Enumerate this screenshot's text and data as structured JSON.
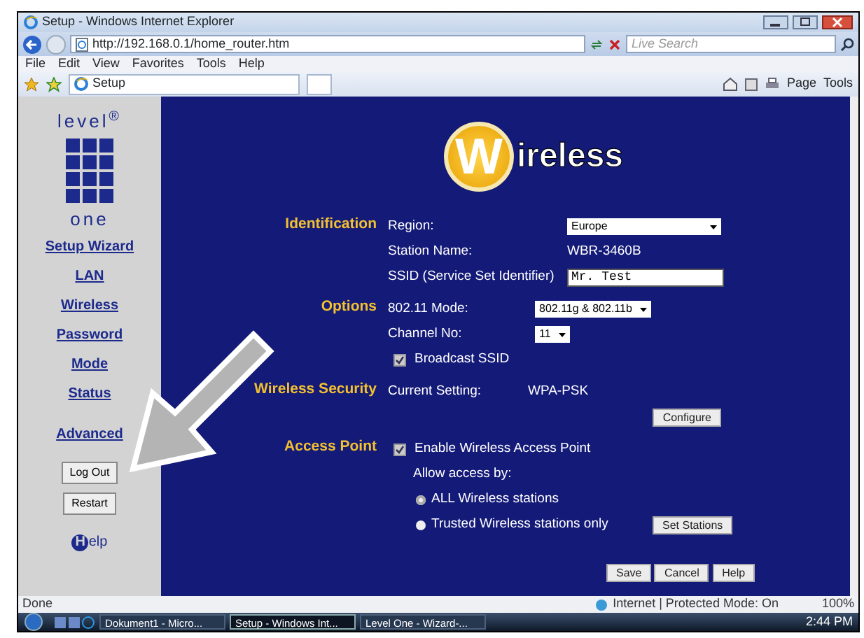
{
  "browser": {
    "title": "Setup - Windows Internet Explorer",
    "address": "http://192.168.0.1/home_router.htm",
    "search_placeholder": "Live Search",
    "menu": [
      "File",
      "Edit",
      "View",
      "Favorites",
      "Tools",
      "Help"
    ],
    "tab": "Setup",
    "tools": [
      "Page",
      "Tools"
    ]
  },
  "sidebar": {
    "logo": {
      "top": "level",
      "mark": "®",
      "bottom": "one"
    },
    "links": [
      "Setup Wizard",
      "LAN",
      "Wireless",
      "Password",
      "Mode",
      "Status"
    ],
    "advanced": "Advanced",
    "buttons": [
      "Log Out",
      "Restart"
    ],
    "help": {
      "letter": "H",
      "rest": "elp"
    }
  },
  "main": {
    "logo": {
      "letter": "W",
      "rest": "ireless"
    },
    "sections": [
      {
        "title": "Identification",
        "rows": [
          {
            "kind": "select",
            "label": "Region:",
            "value": "Europe"
          },
          {
            "kind": "text",
            "label": "Station Name:",
            "value": "WBR-3460B"
          },
          {
            "kind": "input",
            "label": "SSID (Service Set Identifier)",
            "value": "Mr. Test"
          }
        ]
      },
      {
        "title": "Options",
        "rows": [
          {
            "kind": "select",
            "label": "802.11 Mode:",
            "value": "802.11g & 802.11b"
          },
          {
            "kind": "select",
            "label": "Channel No:",
            "value": "11"
          },
          {
            "kind": "checkbox",
            "label": "Broadcast SSID",
            "checked": true
          }
        ]
      },
      {
        "title": "Wireless Security",
        "rows": [
          {
            "kind": "text",
            "label": "Current Setting:",
            "value": "WPA-PSK"
          },
          {
            "kind": "button",
            "label": "Configure"
          }
        ]
      },
      {
        "title": "Access Point",
        "rows": [
          {
            "kind": "checkbox",
            "label": "Enable Wireless Access Point",
            "checked": true
          },
          {
            "kind": "note",
            "label": "Allow access by:"
          },
          {
            "kind": "radio",
            "label": "ALL Wireless stations",
            "selected": true
          },
          {
            "kind": "radio",
            "label": "Trusted Wireless stations only",
            "selected": false,
            "button": "Set Stations"
          }
        ]
      }
    ],
    "actions": [
      "Save",
      "Cancel",
      "Help"
    ]
  },
  "status": {
    "text": "Done",
    "zone": "Internet | Protected Mode: On",
    "zoom": "100%"
  },
  "taskbar": {
    "items": [
      {
        "label": "Dokument1 - Micro...",
        "selected": false
      },
      {
        "label": "Setup - Windows Int...",
        "selected": true
      },
      {
        "label": "Level One - Wizard-...",
        "selected": false
      }
    ],
    "clock": "2:44 PM"
  }
}
